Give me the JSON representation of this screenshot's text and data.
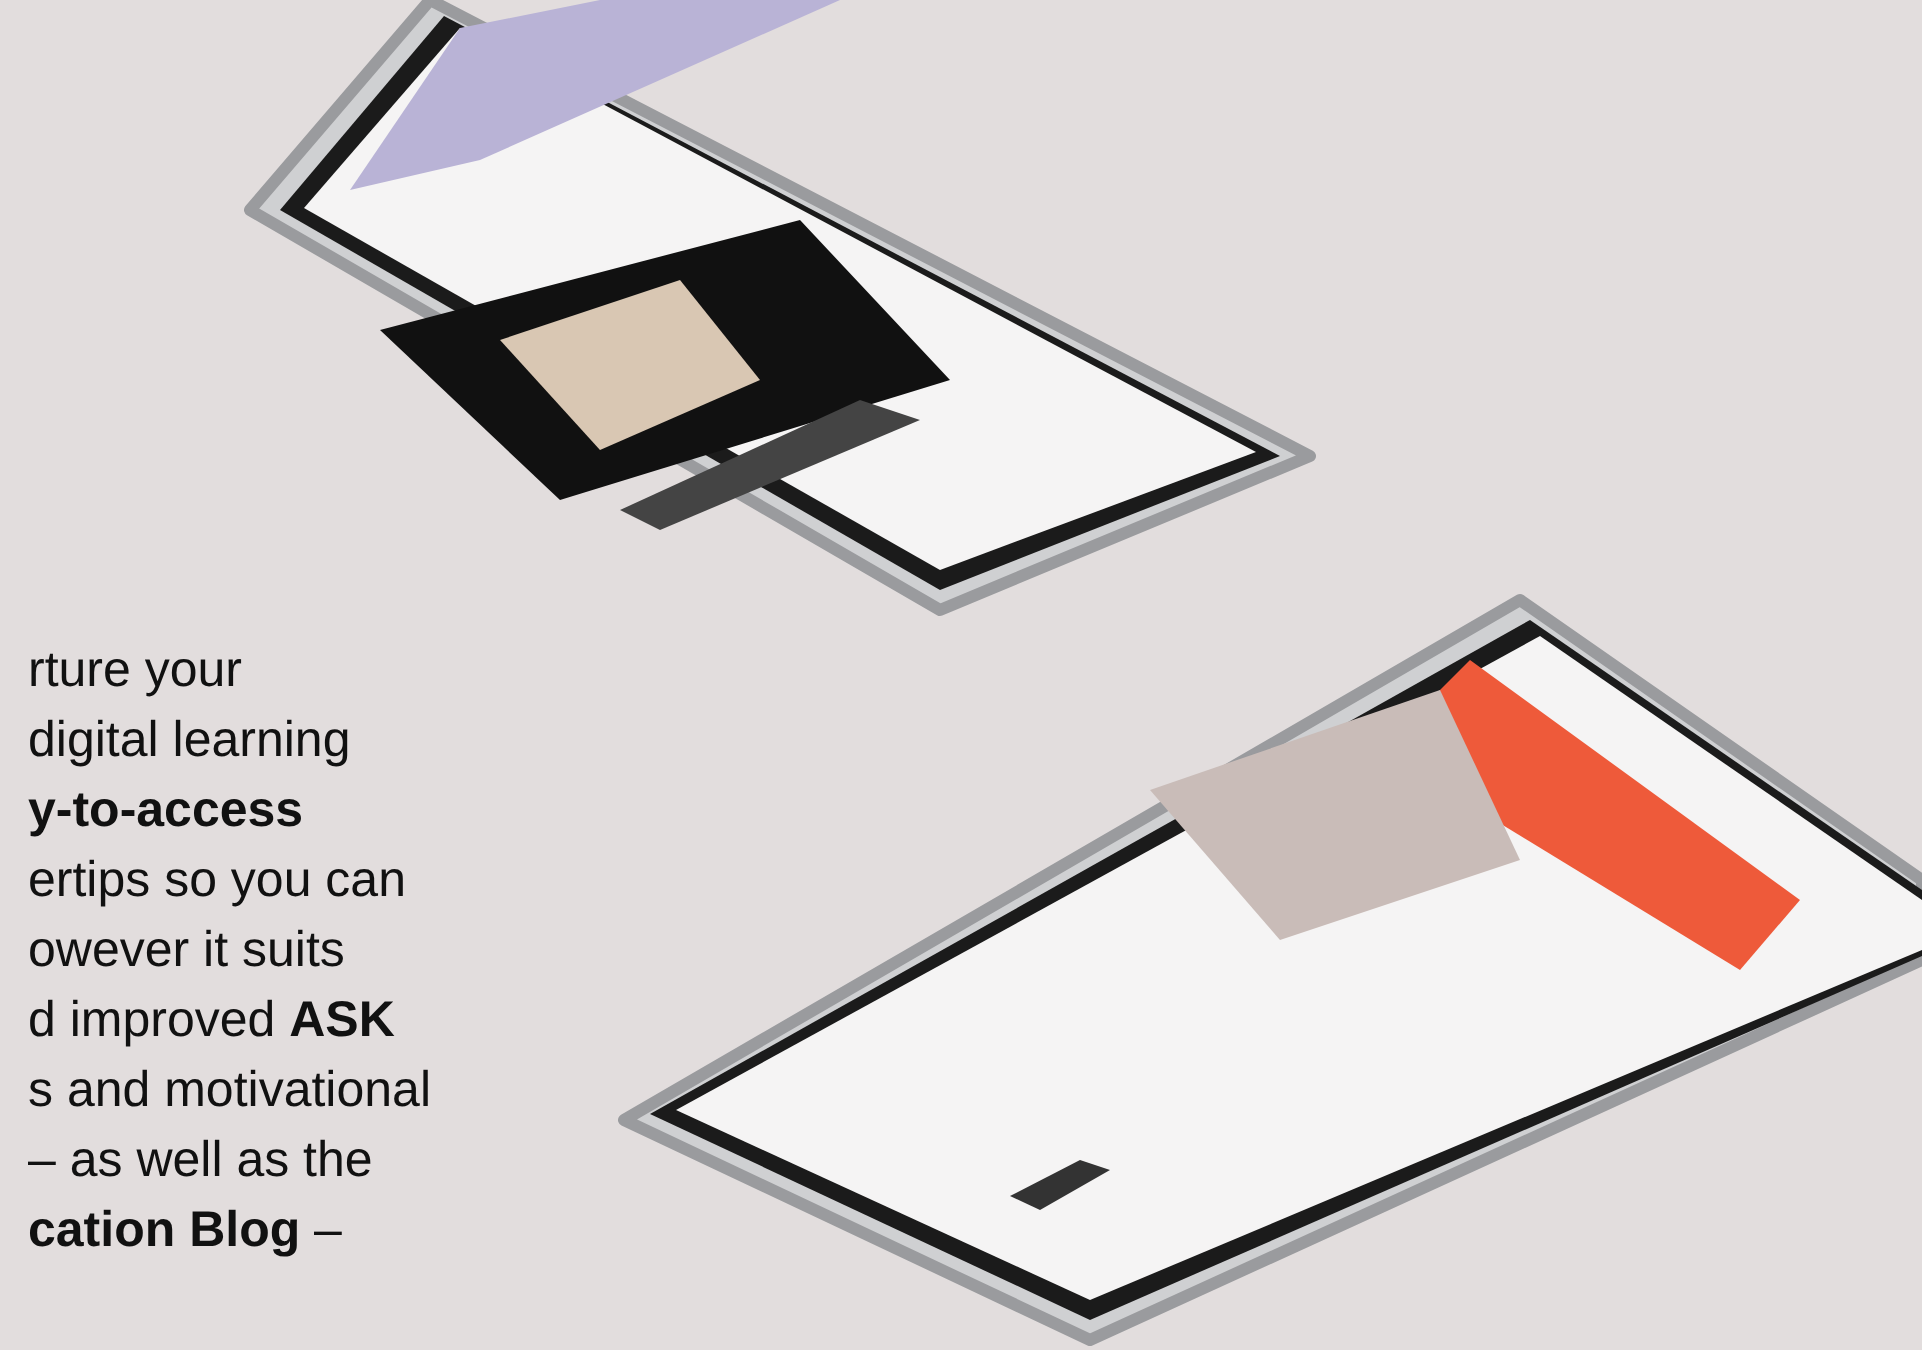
{
  "intro": {
    "lines": [
      "rture your",
      "digital learning",
      "**y-to-access**",
      "ertips so you can",
      "owever it suits",
      "d improved **ASK**",
      "s and motivational",
      "– as well as the",
      "**cation Blog** –"
    ]
  }
}
